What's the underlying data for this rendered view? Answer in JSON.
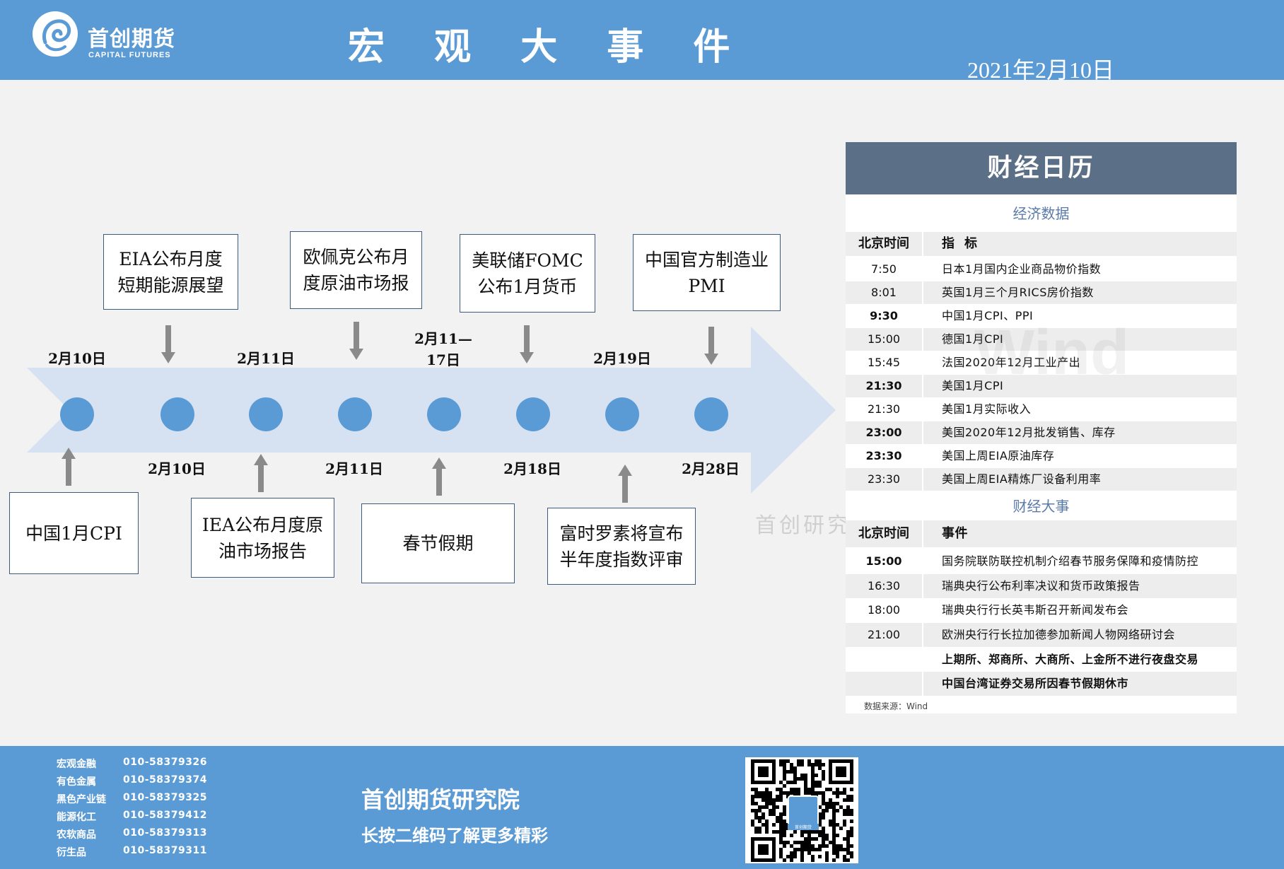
{
  "header": {
    "logo_cn": "首创期货",
    "logo_en": "CAPITAL FUTURES",
    "title": "宏 观 大 事 件",
    "date": "2021年2月10日",
    "colors": {
      "header_bg": "#5b9bd5",
      "arrow": "#d6e2f2",
      "dot": "#5b9bd5"
    }
  },
  "timeline": {
    "top_dates": [
      "2月10日",
      "2月11日",
      "2月11—\n17日",
      "2月19日"
    ],
    "bottom_dates": [
      "2月10日",
      "2月11日",
      "2月18日",
      "2月28日"
    ],
    "top_events": [
      "EIA公布月度\n短期能源展望",
      "欧佩克公布月\n度原油市场报",
      "美联储FOMC\n公布1月货币",
      "中国官方制造业\nPMI"
    ],
    "bottom_events": [
      "中国1月CPI",
      "IEA公布月度原\n油市场报告",
      "春节假期",
      "富时罗素将宣布\n半年度指数评审"
    ]
  },
  "calendar": {
    "title": "财经日历",
    "econ_section": "经济数据",
    "econ_header": {
      "time": "北京时间",
      "item": "指  标"
    },
    "econ_rows": [
      {
        "time": "7:50",
        "item": "日本1月国内企业商品物价指数",
        "bold": false
      },
      {
        "time": "8:01",
        "item": "英国1月三个月RICS房价指数",
        "bold": false
      },
      {
        "time": "9:30",
        "item": "中国1月CPI、PPI",
        "bold": true
      },
      {
        "time": "15:00",
        "item": "德国1月CPI",
        "bold": false
      },
      {
        "time": "15:45",
        "item": "法国2020年12月工业产出",
        "bold": false
      },
      {
        "time": "21:30",
        "item": "美国1月CPI",
        "bold": true
      },
      {
        "time": "21:30",
        "item": "美国1月实际收入",
        "bold": false
      },
      {
        "time": "23:00",
        "item": "美国2020年12月批发销售、库存",
        "bold": true
      },
      {
        "time": "23:30",
        "item": "美国上周EIA原油库存",
        "bold": true
      },
      {
        "time": "23:30",
        "item": "美国上周EIA精炼厂设备利用率",
        "bold": false
      }
    ],
    "event_section": "财经大事",
    "event_header": {
      "time": "北京时间",
      "item": "事件"
    },
    "event_rows": [
      {
        "time": "15:00",
        "item": "国务院联防联控机制介绍春节服务保障和疫情防控",
        "bold": true
      },
      {
        "time": "16:30",
        "item": "瑞典央行公布利率决议和货币政策报告",
        "bold": false
      },
      {
        "time": "18:00",
        "item": "瑞典央行行长英韦斯召开新闻发布会",
        "bold": false
      },
      {
        "time": "21:00",
        "item": "欧洲央行行长拉加德参加新闻人物网络研讨会",
        "bold": false
      },
      {
        "time": "",
        "item": "上期所、郑商所、大商所、上金所不进行夜盘交易",
        "bold": true
      },
      {
        "time": "",
        "item": "中国台湾证券交易所因春节假期休市",
        "bold": true
      }
    ],
    "source": "数据来源：Wind",
    "watermark": "Wind",
    "side_watermark": "首创研究"
  },
  "footer": {
    "contacts": [
      {
        "dept": "宏观金融",
        "phone": "010-58379326"
      },
      {
        "dept": "有色金属",
        "phone": "010-58379374"
      },
      {
        "dept": "黑色产业链",
        "phone": "010-58379325"
      },
      {
        "dept": "能源化工",
        "phone": "010-58379412"
      },
      {
        "dept": "农软商品",
        "phone": "010-58379313"
      },
      {
        "dept": "衍生品",
        "phone": "010-58379311"
      }
    ],
    "title": "首创期货研究院",
    "subtitle": "长按二维码了解更多精彩",
    "qr_label": "首创期货"
  }
}
